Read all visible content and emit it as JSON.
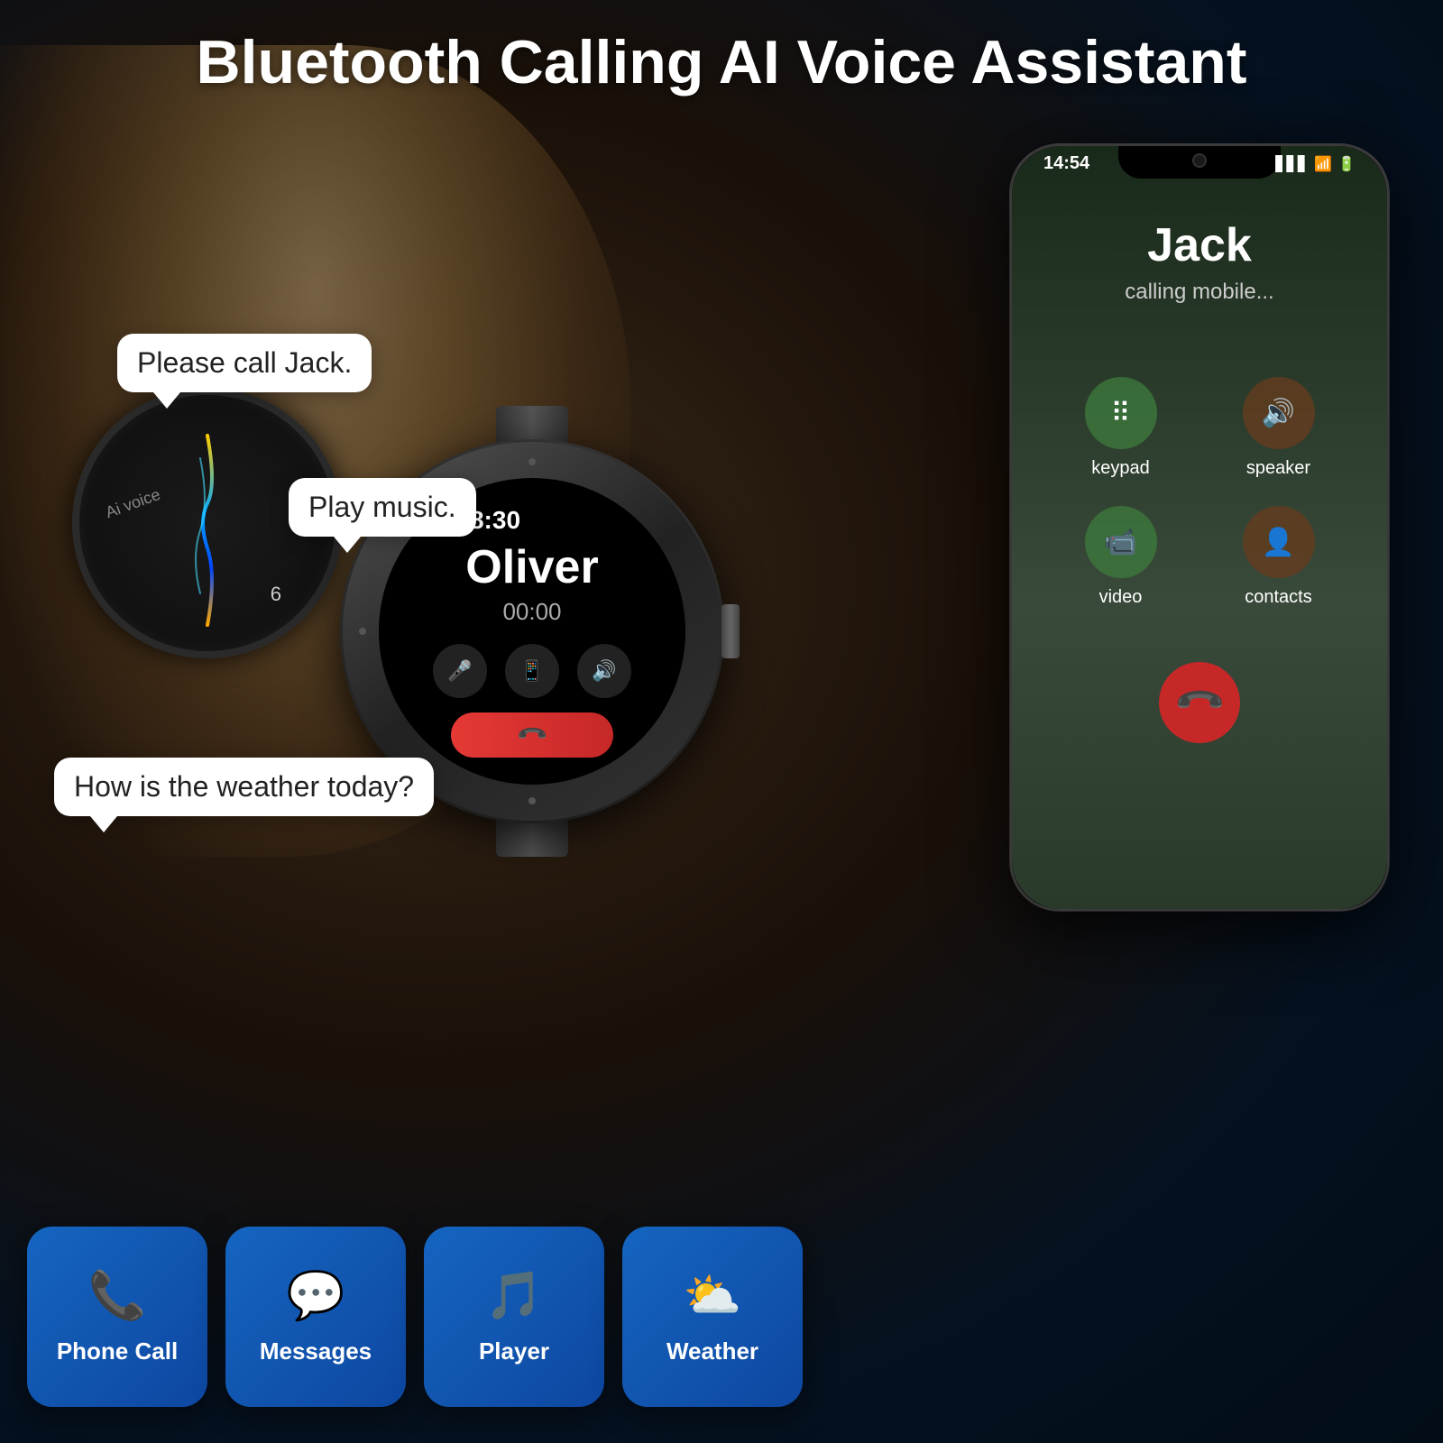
{
  "page": {
    "title": "Bluetooth Calling AI Voice Assistant",
    "background_color": "#0a1628"
  },
  "bubbles": {
    "call": "Please call Jack.",
    "music": "Play music.",
    "weather": "How is the weather today?"
  },
  "watch_small": {
    "ai_label": "Ai voice",
    "number": "6"
  },
  "watch_large": {
    "time": "08:30",
    "caller": "Oliver",
    "duration": "00:00",
    "ctrl1": "🎤",
    "ctrl2": "📱",
    "ctrl3": "🔊",
    "end_icon": "📞"
  },
  "phone": {
    "status_time": "14:54",
    "caller_name": "Jack",
    "caller_status": "calling mobile...",
    "keypad_label": "keypad",
    "speaker_label": "speaker",
    "contacts_label": "contacts",
    "decline_icon": "📞"
  },
  "features": [
    {
      "id": "phone-call",
      "icon": "📞",
      "label": "Phone Call"
    },
    {
      "id": "messages",
      "icon": "💬",
      "label": "Messages"
    },
    {
      "id": "player",
      "icon": "🎵",
      "label": "Player"
    },
    {
      "id": "weather",
      "icon": "⛅",
      "label": "Weather"
    }
  ]
}
